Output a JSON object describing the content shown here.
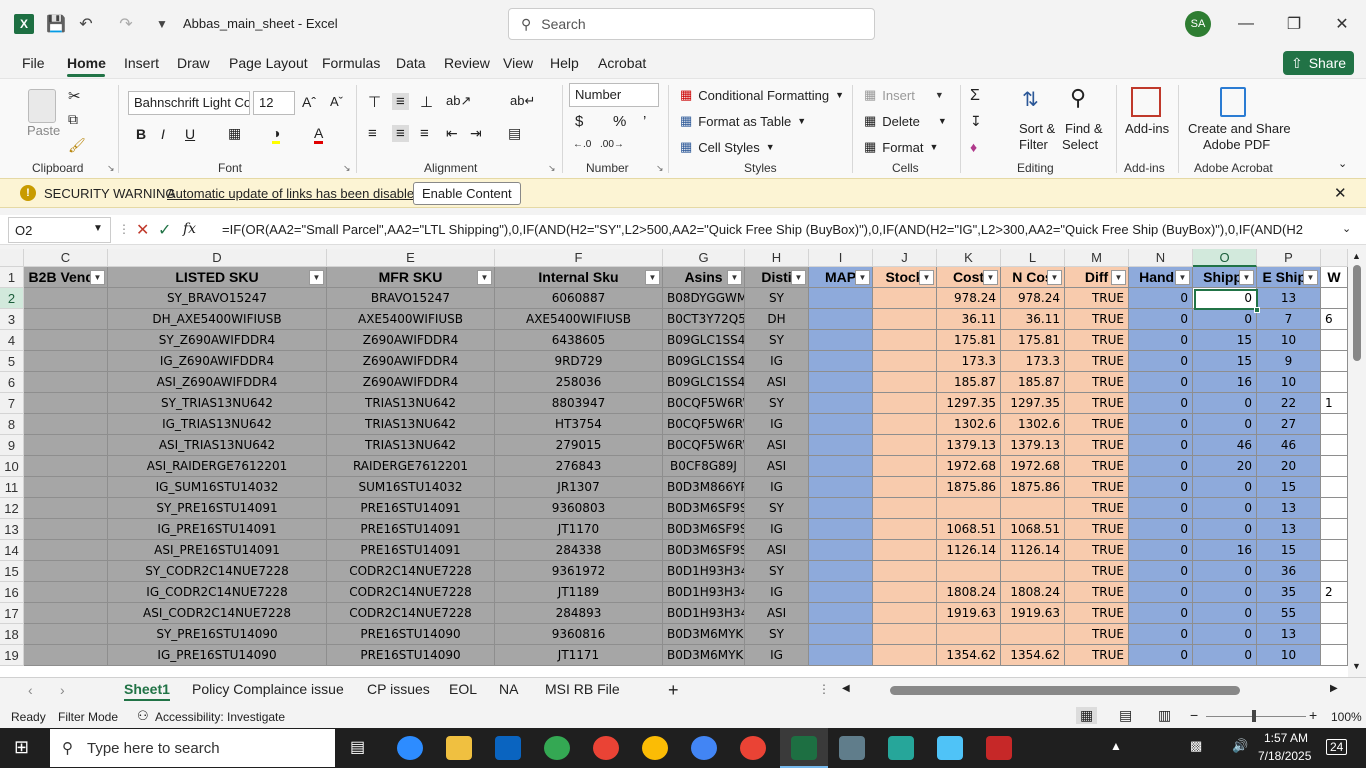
{
  "titlebar": {
    "filename": "Abbas_main_sheet  -  Excel",
    "search_placeholder": "Search",
    "avatar_initials": "SA"
  },
  "menu": [
    "File",
    "Home",
    "Insert",
    "Draw",
    "Page Layout",
    "Formulas",
    "Data",
    "Review",
    "View",
    "Help",
    "Acrobat"
  ],
  "share_label": "Share",
  "ribbon": {
    "clipboard": {
      "paste": "Paste",
      "group": "Clipboard"
    },
    "font": {
      "name": "Bahnschrift Light Co",
      "size": "12",
      "group": "Font"
    },
    "alignment": {
      "group": "Alignment"
    },
    "number": {
      "format": "Number",
      "group": "Number"
    },
    "styles": {
      "conditional": "Conditional Formatting",
      "table": "Format as Table",
      "cell": "Cell Styles",
      "group": "Styles"
    },
    "cells": {
      "insert": "Insert",
      "delete": "Delete",
      "format": "Format",
      "group": "Cells"
    },
    "editing": {
      "sort1": "Sort &",
      "sort2": "Filter",
      "find1": "Find &",
      "find2": "Select",
      "group": "Editing"
    },
    "addins": {
      "label": "Add-ins",
      "group": "Add-ins"
    },
    "acrobat": {
      "l1": "Create and Share",
      "l2": "Adobe PDF",
      "group": "Adobe Acrobat"
    }
  },
  "security": {
    "title": "SECURITY WARNING",
    "message": "Automatic update of links has been disabled",
    "button": "Enable Content"
  },
  "formula_bar": {
    "name_box": "O2",
    "fx": "fx",
    "formula": "=IF(OR(AA2=\"Small Parcel\",AA2=\"LTL Shipping\"),0,IF(AND(H2=\"SY\",L2>500,AA2=\"Quick Free Ship (BuyBox)\"),0,IF(AND(H2=\"IG\",L2>300,AA2=\"Quick Free Ship (BuyBox)\"),0,IF(AND(H2"
  },
  "sheet": {
    "columns": [
      "C",
      "D",
      "E",
      "F",
      "G",
      "H",
      "I",
      "J",
      "K",
      "L",
      "M",
      "N",
      "O",
      "P",
      ""
    ],
    "headers": [
      "B2B Vendo",
      "LISTED SKU",
      "MFR SKU",
      "Internal Sku",
      "Asins",
      "Disti",
      "MAP",
      "Stock",
      "Cost",
      "N Cos",
      "Diff",
      "Handli",
      "Shippi",
      "E Shipp",
      "W"
    ],
    "row_numbers": [
      "1",
      "2",
      "3",
      "4",
      "5",
      "6",
      "7",
      "8",
      "9",
      "10",
      "11",
      "12",
      "13",
      "14",
      "15",
      "16",
      "17",
      "18",
      "19"
    ],
    "rows": [
      [
        "",
        "SY_BRAVO15247",
        "BRAVO15247",
        "6060887",
        "B08DYGGWML",
        "SY",
        "",
        "",
        "978.24",
        "978.24",
        "TRUE",
        "0",
        "0",
        "13",
        ""
      ],
      [
        "",
        "DH_AXE5400WIFIUSB",
        "AXE5400WIFIUSB",
        "AXE5400WIFIUSB",
        "B0CT3Y72Q5",
        "DH",
        "",
        "",
        "36.11",
        "36.11",
        "TRUE",
        "0",
        "0",
        "7",
        "6"
      ],
      [
        "",
        "SY_Z690AWIFDDR4",
        "Z690AWIFDDR4",
        "6438605",
        "B09GLC1SS4",
        "SY",
        "",
        "",
        "175.81",
        "175.81",
        "TRUE",
        "0",
        "15",
        "10",
        ""
      ],
      [
        "",
        "IG_Z690AWIFDDR4",
        "Z690AWIFDDR4",
        "9RD729",
        "B09GLC1SS4",
        "IG",
        "",
        "",
        "173.3",
        "173.3",
        "TRUE",
        "0",
        "15",
        "9",
        ""
      ],
      [
        "",
        "ASI_Z690AWIFDDR4",
        "Z690AWIFDDR4",
        "258036",
        "B09GLC1SS4",
        "ASI",
        "",
        "",
        "185.87",
        "185.87",
        "TRUE",
        "0",
        "16",
        "10",
        ""
      ],
      [
        "",
        "SY_TRIAS13NU642",
        "TRIAS13NU642",
        "8803947",
        "B0CQF5W6RW",
        "SY",
        "",
        "",
        "1297.35",
        "1297.35",
        "TRUE",
        "0",
        "0",
        "22",
        "1"
      ],
      [
        "",
        "IG_TRIAS13NU642",
        "TRIAS13NU642",
        "HT3754",
        "B0CQF5W6RW",
        "IG",
        "",
        "",
        "1302.6",
        "1302.6",
        "TRUE",
        "0",
        "0",
        "27",
        ""
      ],
      [
        "",
        "ASI_TRIAS13NU642",
        "TRIAS13NU642",
        "279015",
        "B0CQF5W6RW",
        "ASI",
        "",
        "",
        "1379.13",
        "1379.13",
        "TRUE",
        "0",
        "46",
        "46",
        ""
      ],
      [
        "",
        "ASI_RAIDERGE7612201",
        "RAIDERGE7612201",
        "276843",
        "B0CF8G89J",
        "ASI",
        "",
        "",
        "1972.68",
        "1972.68",
        "TRUE",
        "0",
        "20",
        "20",
        ""
      ],
      [
        "",
        "IG_SUM16STU14032",
        "SUM16STU14032",
        "JR1307",
        "B0D3M866YP",
        "IG",
        "",
        "",
        "1875.86",
        "1875.86",
        "TRUE",
        "0",
        "0",
        "15",
        ""
      ],
      [
        "",
        "SY_PRE16STU14091",
        "PRE16STU14091",
        "9360803",
        "B0D3M6SF9S",
        "SY",
        "",
        "",
        "",
        "",
        "TRUE",
        "0",
        "0",
        "13",
        ""
      ],
      [
        "",
        "IG_PRE16STU14091",
        "PRE16STU14091",
        "JT1170",
        "B0D3M6SF9S",
        "IG",
        "",
        "",
        "1068.51",
        "1068.51",
        "TRUE",
        "0",
        "0",
        "13",
        ""
      ],
      [
        "",
        "ASI_PRE16STU14091",
        "PRE16STU14091",
        "284338",
        "B0D3M6SF9S",
        "ASI",
        "",
        "",
        "1126.14",
        "1126.14",
        "TRUE",
        "0",
        "16",
        "15",
        ""
      ],
      [
        "",
        "SY_CODR2C14NUE7228",
        "CODR2C14NUE7228",
        "9361972",
        "B0D1H93H34",
        "SY",
        "",
        "",
        "",
        "",
        "TRUE",
        "0",
        "0",
        "36",
        ""
      ],
      [
        "",
        "IG_CODR2C14NUE7228",
        "CODR2C14NUE7228",
        "JT1189",
        "B0D1H93H34",
        "IG",
        "",
        "",
        "1808.24",
        "1808.24",
        "TRUE",
        "0",
        "0",
        "35",
        "2"
      ],
      [
        "",
        "ASI_CODR2C14NUE7228",
        "CODR2C14NUE7228",
        "284893",
        "B0D1H93H34",
        "ASI",
        "",
        "",
        "1919.63",
        "1919.63",
        "TRUE",
        "0",
        "0",
        "55",
        ""
      ],
      [
        "",
        "SY_PRE16STU14090",
        "PRE16STU14090",
        "9360816",
        "B0D3M6MYKG",
        "SY",
        "",
        "",
        "",
        "",
        "TRUE",
        "0",
        "0",
        "13",
        ""
      ],
      [
        "",
        "IG_PRE16STU14090",
        "PRE16STU14090",
        "JT1171",
        "B0D3M6MYKG",
        "IG",
        "",
        "",
        "1354.62",
        "1354.62",
        "TRUE",
        "0",
        "0",
        "10",
        ""
      ]
    ],
    "fill_colors": [
      "#a6a6a6",
      "#a6a6a6",
      "#a6a6a6",
      "#a6a6a6",
      "#a6a6a6",
      "#a6a6a6",
      "#8eaadb",
      "#f8cbad",
      "#f8cbad",
      "#f8cbad",
      "#f8cbad",
      "#8eaadb",
      "#8eaadb",
      "#8eaadb",
      "#ffffff"
    ],
    "tabs": [
      "Sheet1",
      "Policy Complaince issue",
      "CP issues",
      "EOL",
      "NA",
      "MSI RB File"
    ]
  },
  "status": {
    "ready": "Ready",
    "mode": "Filter Mode",
    "accessibility": "Accessibility: Investigate",
    "zoom": "100%"
  },
  "taskbar": {
    "search_placeholder": "Type here to search",
    "time": "1:57 AM",
    "date": "7/18/2025",
    "notif": "24"
  }
}
